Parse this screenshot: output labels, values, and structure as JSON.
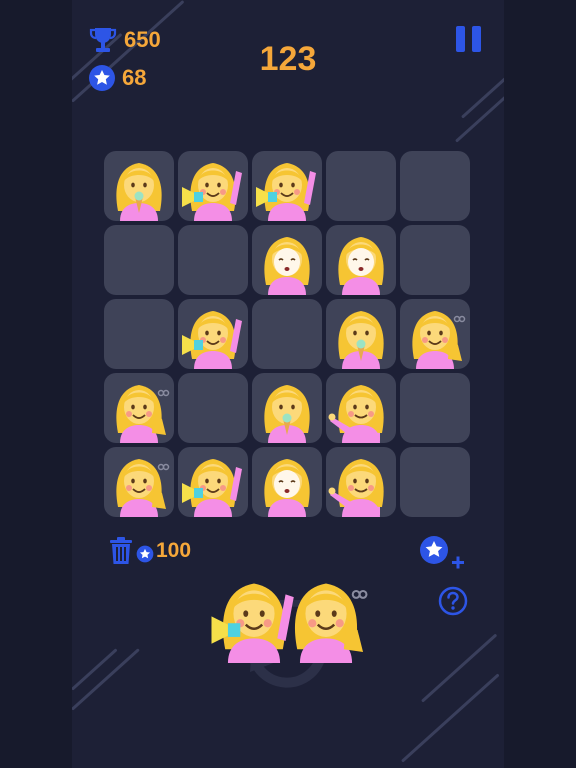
{
  "header": {
    "best_score": "650",
    "stars": "68",
    "current_score": "123"
  },
  "board": {
    "rows": 5,
    "cols": 5,
    "cells": [
      [
        "icecream",
        "megaphone",
        "megaphone",
        "empty",
        "empty"
      ],
      [
        "empty",
        "empty",
        "facemask",
        "facemask",
        "empty"
      ],
      [
        "empty",
        "megaphone",
        "empty",
        "icecream",
        "scissors"
      ],
      [
        "scissors",
        "empty",
        "icecream",
        "pointing",
        "empty"
      ],
      [
        "scissors",
        "megaphone",
        "facemask",
        "pointing",
        "empty"
      ]
    ]
  },
  "tools": {
    "trash_cost": "100"
  },
  "next_piece": [
    "megaphone",
    "scissors"
  ],
  "icons": {
    "best": "trophy-icon",
    "stars": "star-icon",
    "pause": "pause-icon",
    "trash": "trash-icon",
    "add_stars": "star-plus-icon",
    "help": "question-icon"
  },
  "colors": {
    "accent_orange": "#f5a73a",
    "accent_blue": "#2d55e6",
    "tile": "#3f4358",
    "background": "#1d2036"
  }
}
